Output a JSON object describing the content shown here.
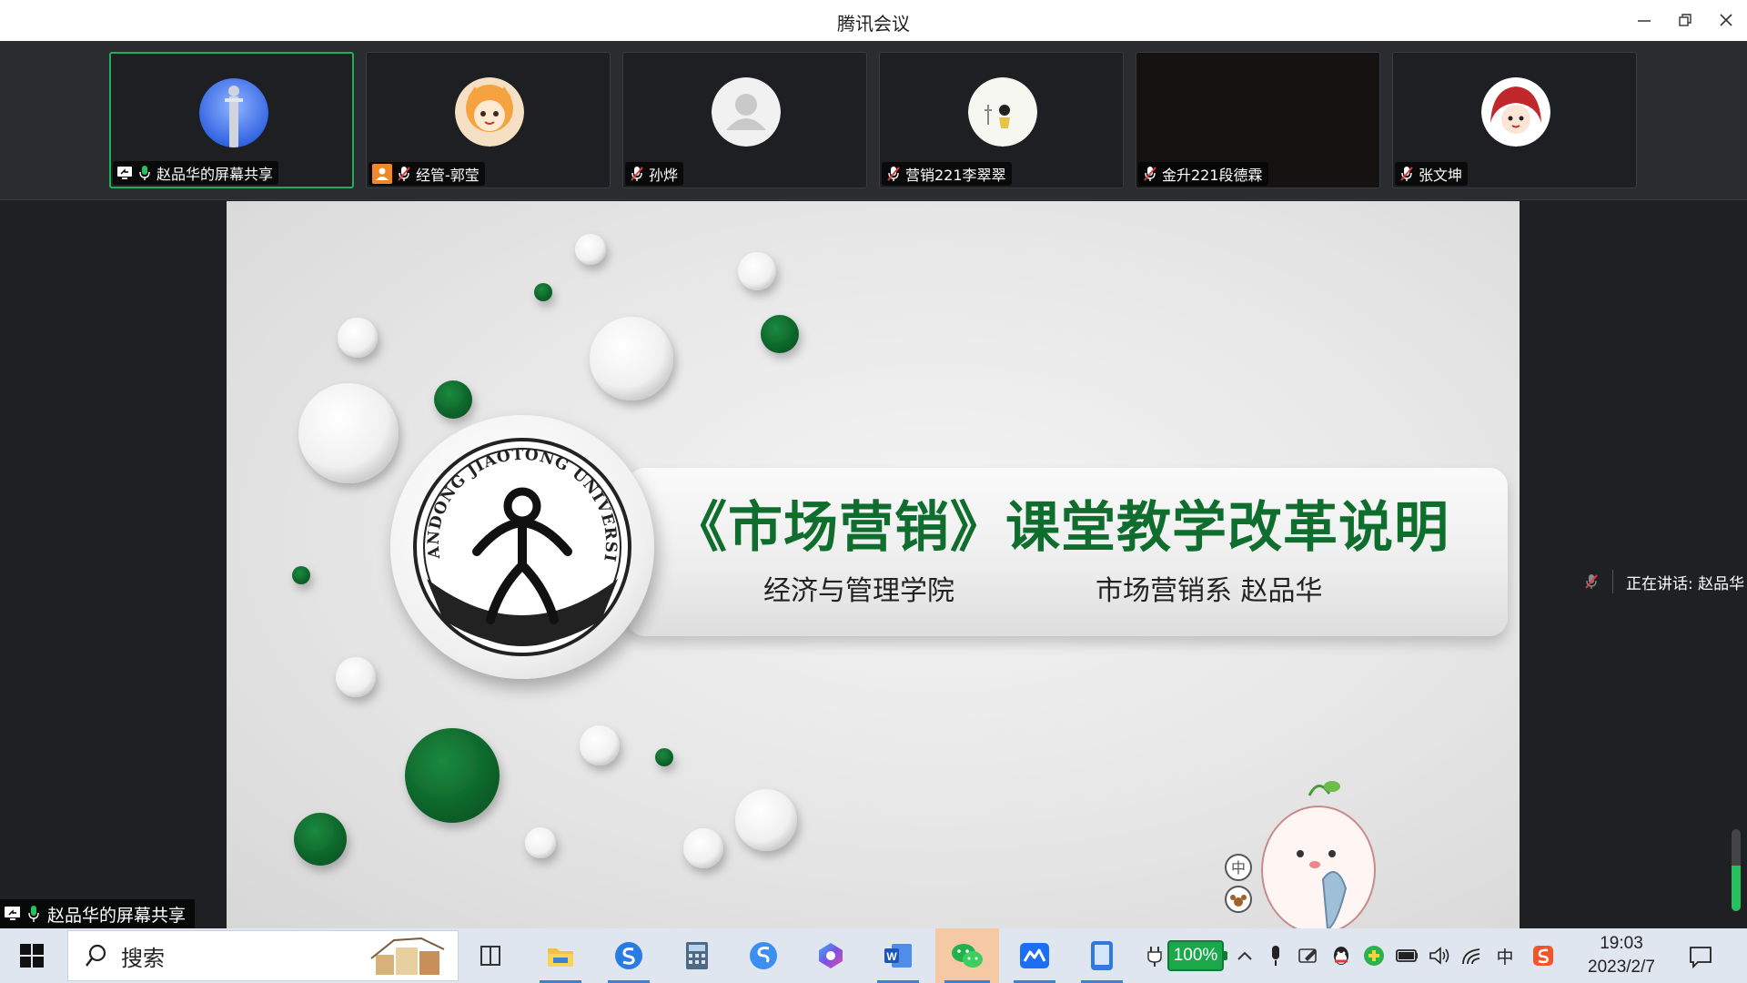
{
  "window": {
    "title": "腾讯会议"
  },
  "participants": [
    {
      "name": "赵品华的屏幕共享",
      "active": true,
      "mic": "on",
      "sharing": true
    },
    {
      "name": "经管-郭莹",
      "active": false,
      "mic": "muted"
    },
    {
      "name": "孙烨",
      "active": false,
      "mic": "muted"
    },
    {
      "name": "营销221李翠翠",
      "active": false,
      "mic": "muted"
    },
    {
      "name": "金升221段德霖",
      "active": false,
      "mic": "muted"
    },
    {
      "name": "张文坤",
      "active": false,
      "mic": "muted"
    }
  ],
  "slide": {
    "title": "《市场营销》课堂教学改革说明",
    "subtitle_left": "经济与管理学院",
    "subtitle_right": "市场营销系 赵品华",
    "logo_text": "SHANDONG JIAOTONG UNIVERSITY",
    "accent_color": "#0f6e2d"
  },
  "speaking": {
    "text": "正在讲话: 赵品华"
  },
  "share_label": {
    "text": "赵品华的屏幕共享"
  },
  "ime_chars": {
    "zhong": "中"
  },
  "taskbar": {
    "search_placeholder": "搜索",
    "apps": [
      "task-view",
      "file-explorer",
      "sogou-browser",
      "calculator",
      "sogou-app",
      "copilot",
      "word",
      "wechat",
      "tencent-meeting",
      "phone-link"
    ],
    "tray_icons": [
      "power-plug-icon",
      "chevron-up-icon",
      "microphone-icon",
      "pen-icon",
      "qq-icon",
      "app-icon",
      "battery-icon",
      "volume-icon",
      "wifi-icon",
      "ime-icon",
      "sogou-ime-icon"
    ],
    "battery_percent": "100%",
    "battery_level": 100,
    "ime_label": "中",
    "time": "19:03",
    "date": "2023/2/7"
  }
}
